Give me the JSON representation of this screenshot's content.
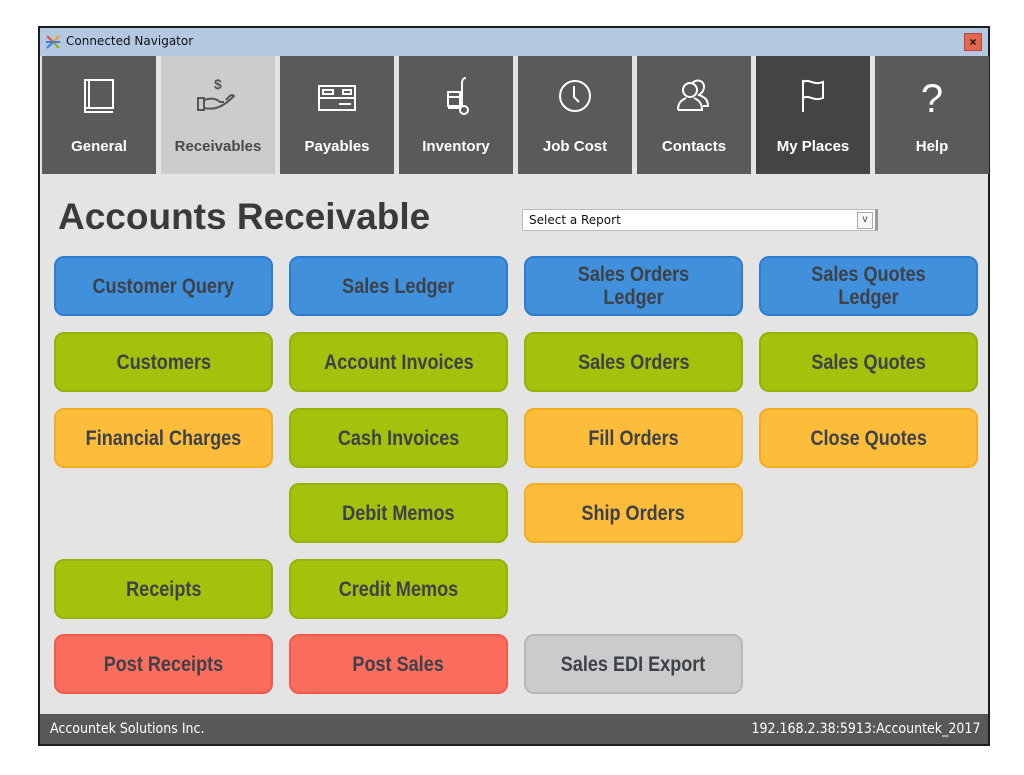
{
  "window": {
    "title": "Connected Navigator",
    "close_label": "×"
  },
  "nav": {
    "tabs": [
      {
        "label": "General",
        "icon": "book-icon",
        "state": "normal"
      },
      {
        "label": "Receivables",
        "icon": "hand-dollar-icon",
        "state": "active"
      },
      {
        "label": "Payables",
        "icon": "check-card-icon",
        "state": "normal"
      },
      {
        "label": "Inventory",
        "icon": "hand-truck-icon",
        "state": "normal"
      },
      {
        "label": "Job Cost",
        "icon": "clock-icon",
        "state": "normal"
      },
      {
        "label": "Contacts",
        "icon": "people-icon",
        "state": "normal"
      },
      {
        "label": "My Places",
        "icon": "flag-icon",
        "state": "dark"
      },
      {
        "label": "Help",
        "icon": "question-icon",
        "state": "normal"
      }
    ]
  },
  "page": {
    "heading": "Accounts Receivable",
    "report_select": {
      "value": "Select a Report",
      "arrow": "v"
    }
  },
  "buttons": [
    {
      "label": "Customer Query",
      "color": "blue"
    },
    {
      "label": "Sales Ledger",
      "color": "blue"
    },
    {
      "label": "Sales Orders Ledger",
      "color": "blue"
    },
    {
      "label": "Sales Quotes Ledger",
      "color": "blue"
    },
    {
      "label": "Customers",
      "color": "green"
    },
    {
      "label": "Account Invoices",
      "color": "green"
    },
    {
      "label": "Sales Orders",
      "color": "green"
    },
    {
      "label": "Sales Quotes",
      "color": "green"
    },
    {
      "label": "Financial Charges",
      "color": "orange"
    },
    {
      "label": "Cash Invoices",
      "color": "green"
    },
    {
      "label": "Fill Orders",
      "color": "orange"
    },
    {
      "label": "Close Quotes",
      "color": "orange"
    },
    {
      "label": "Debit Memos",
      "color": "green"
    },
    {
      "label": "Ship Orders",
      "color": "orange"
    },
    {
      "label": "Receipts",
      "color": "green"
    },
    {
      "label": "Credit Memos",
      "color": "green"
    },
    {
      "label": "Post Receipts",
      "color": "red"
    },
    {
      "label": "Post Sales",
      "color": "red"
    },
    {
      "label": "Sales EDI Export",
      "color": "gray"
    }
  ],
  "colors": {
    "blue": "#4190dc",
    "green": "#a4c20c",
    "orange": "#fdbd3a",
    "red": "#fd6d5e",
    "gray": "#cbcbcb",
    "nav_bg": "#5b595a",
    "nav_active": "#cccccc"
  },
  "status": {
    "company": "Accountek Solutions Inc.",
    "connection": "192.168.2.38:5913:Accountek_2017"
  }
}
